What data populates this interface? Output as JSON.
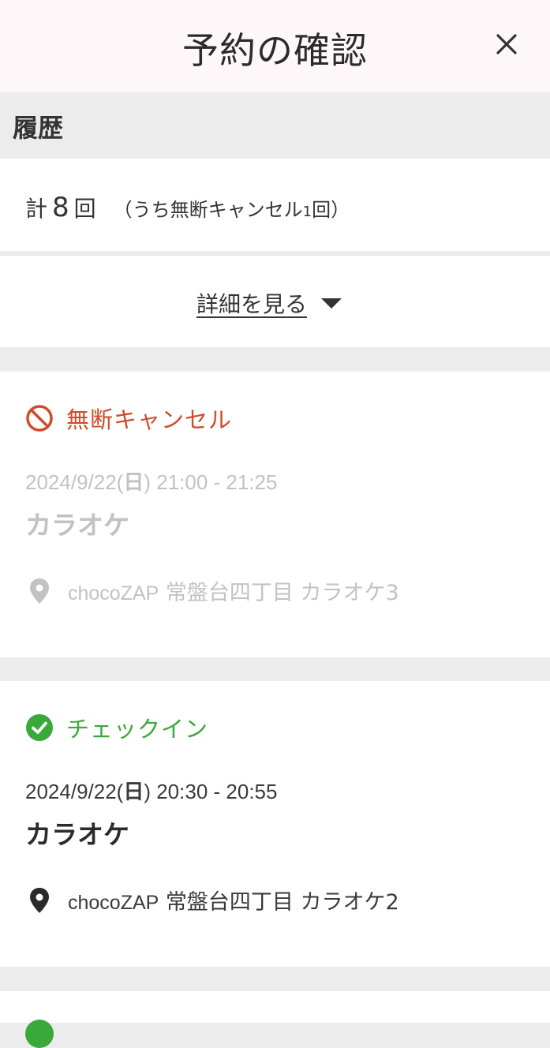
{
  "header": {
    "title": "予約の確認",
    "close_icon": "close-icon"
  },
  "history": {
    "label": "履歴",
    "summary_prefix": "計",
    "total": "8",
    "summary_unit": "回",
    "paren_open": "（うち無断キャンセル",
    "cancel_count": "1",
    "paren_close": "回）"
  },
  "details": {
    "label": "詳細を見る",
    "icon": "caret-down-icon"
  },
  "reservations": [
    {
      "status": "無断キャンセル",
      "status_icon": "no-entry-icon",
      "status_color": "#cf4b2a",
      "date": "2024/9/22(",
      "dow": "日",
      "time": ") 21:00 - 21:25",
      "service": "カラオケ",
      "brand": "chocoZAP",
      "location": " 常盤台四丁目 カラオケ3",
      "pin_icon": "map-pin-icon"
    },
    {
      "status": "チェックイン",
      "status_icon": "check-circle-icon",
      "status_color": "#3aa83a",
      "date": "2024/9/22(",
      "dow": "日",
      "time": ") 20:30 - 20:55",
      "service": "カラオケ",
      "brand": "chocoZAP",
      "location": " 常盤台四丁目 カラオケ2",
      "pin_icon": "map-pin-icon"
    }
  ]
}
